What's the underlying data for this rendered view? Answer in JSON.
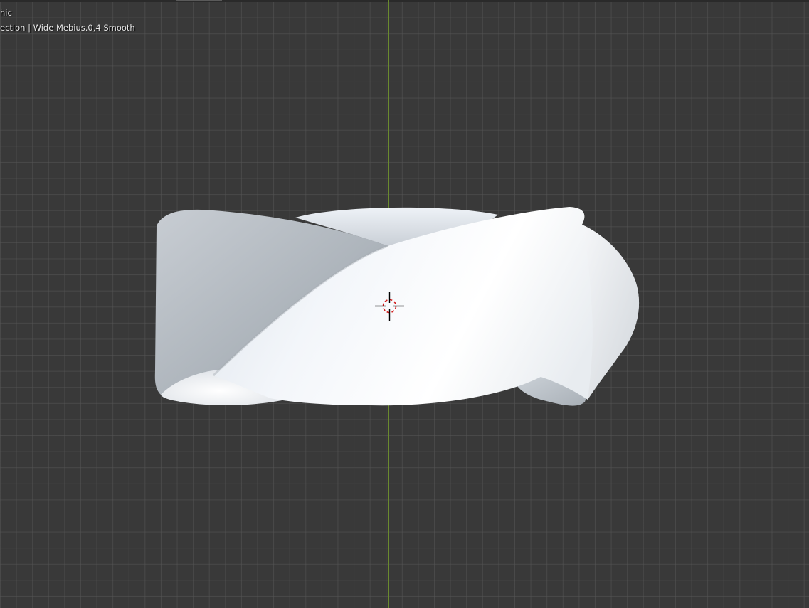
{
  "viewport": {
    "view_name": "hic",
    "object_info": "ection | Wide Mebius.0,4 Smooth",
    "object_icon": "mobius-strip-mesh",
    "cursor_icon": "3d-cursor-icon",
    "colors": {
      "background": "#393939",
      "grid_line": "#565656",
      "x_axis": "#8a4545",
      "y_axis": "#6a8a2f",
      "mesh_light": "#f4f7fb",
      "mesh_shadow": "#9ea6ae",
      "cursor_red": "#d01818"
    }
  }
}
